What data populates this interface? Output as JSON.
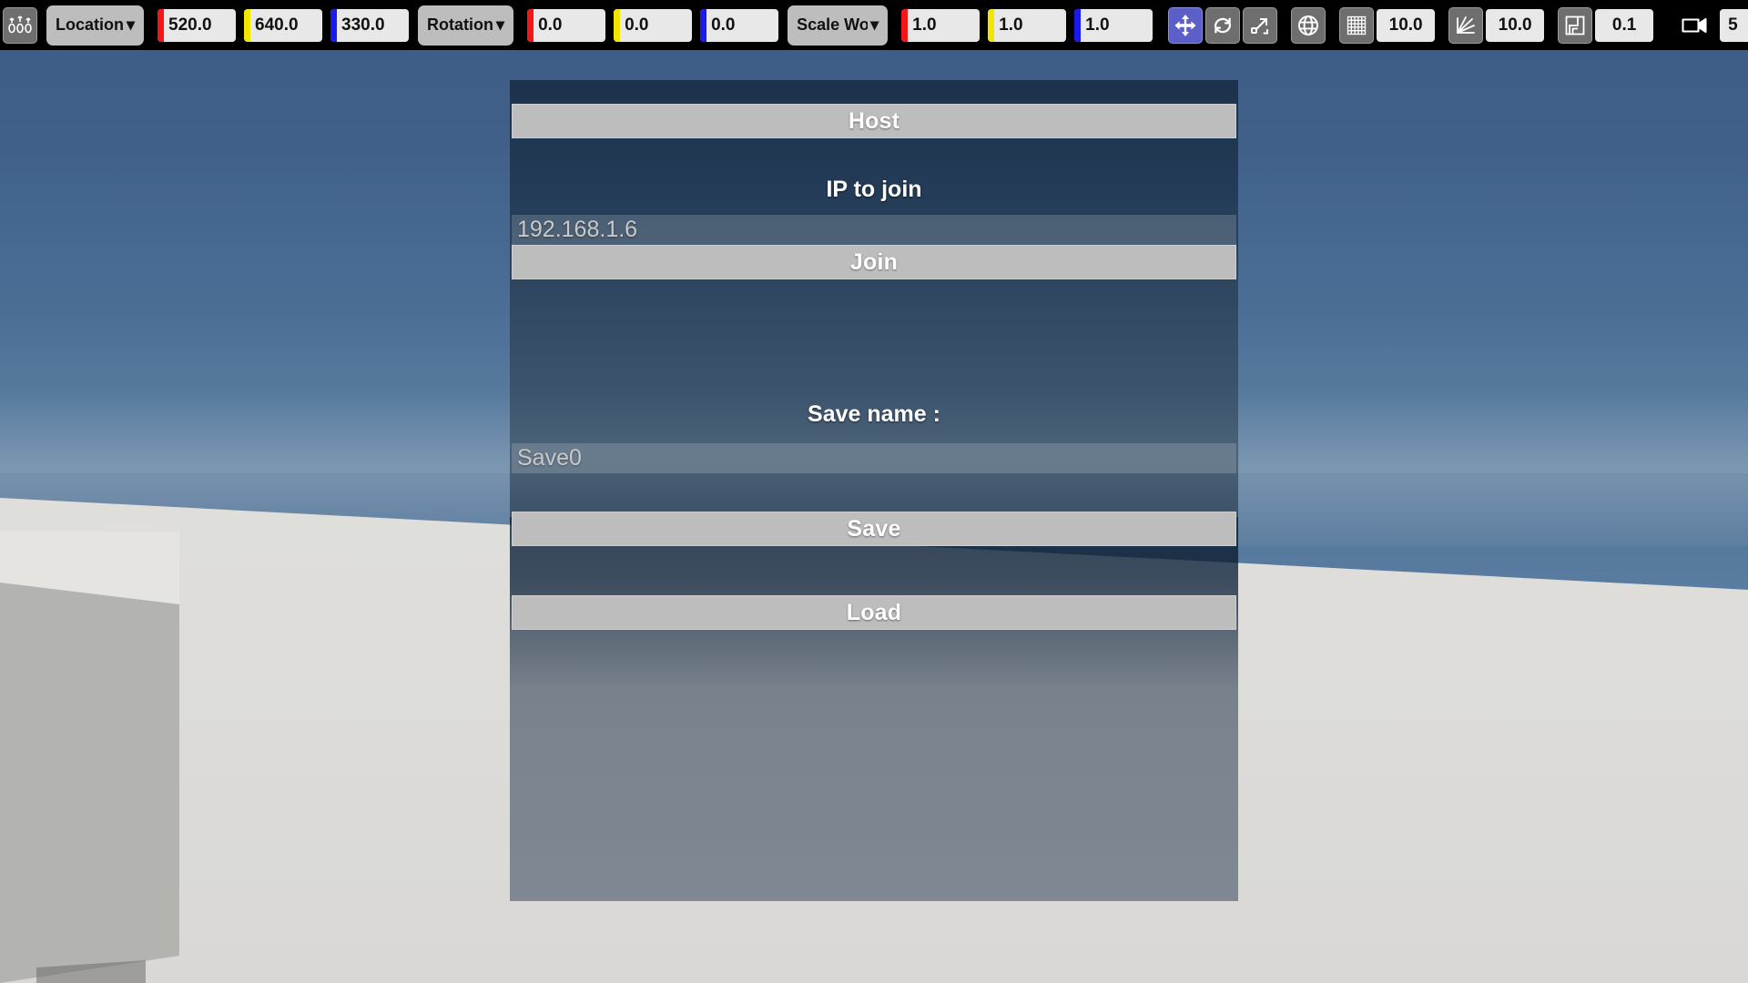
{
  "toolbar": {
    "select_mode_icon": "actor-select-icon",
    "transform_mode": {
      "label": "Location",
      "dropdown_icon": "chevron-down-icon"
    },
    "location": {
      "x": "520.0",
      "y": "640.0",
      "z": "330.0"
    },
    "rotation_mode": {
      "label": "Rotation",
      "dropdown_icon": "chevron-down-icon"
    },
    "rotation": {
      "x": "0.0",
      "y": "0.0",
      "z": "0.0"
    },
    "scale_mode": {
      "label": "Scale Wor",
      "dropdown_icon": "chevron-down-icon"
    },
    "scale": {
      "x": "1.0",
      "y": "1.0",
      "z": "1.0"
    },
    "gizmos": [
      {
        "name": "translate-gizmo-icon",
        "active": true
      },
      {
        "name": "rotate-gizmo-icon",
        "active": false
      },
      {
        "name": "scale-gizmo-icon",
        "active": false
      },
      {
        "name": "world-space-icon",
        "active": false
      }
    ],
    "grid_snap": {
      "icon": "grid-snap-icon",
      "value": "10.0"
    },
    "angle_snap": {
      "icon": "angle-snap-icon",
      "value": "10.0"
    },
    "scale_snap": {
      "icon": "scale-snap-icon",
      "value": "0.1"
    },
    "camera_speed": {
      "icon": "camera-icon",
      "value": "5",
      "expand_icon": "expand-arrow-icon"
    }
  },
  "hud": {
    "host_button": "Host",
    "ip_label": "IP to join",
    "ip_value": "192.168.1.6",
    "join_button": "Join",
    "save_name_label": "Save name :",
    "save_name_value": "Save0",
    "save_button": "Save",
    "load_button": "Load"
  },
  "colors": {
    "axis_x": "#f41616",
    "axis_y": "#f2e500",
    "axis_z": "#1a1af0",
    "gizmo_active": "#5b5fc7",
    "toolbar_bg": "#000000",
    "hud_button": "#bdbdbd",
    "sky_top": "#3c5c86",
    "sky_horizon": "#8497ae",
    "ground": "#e2e1de"
  }
}
